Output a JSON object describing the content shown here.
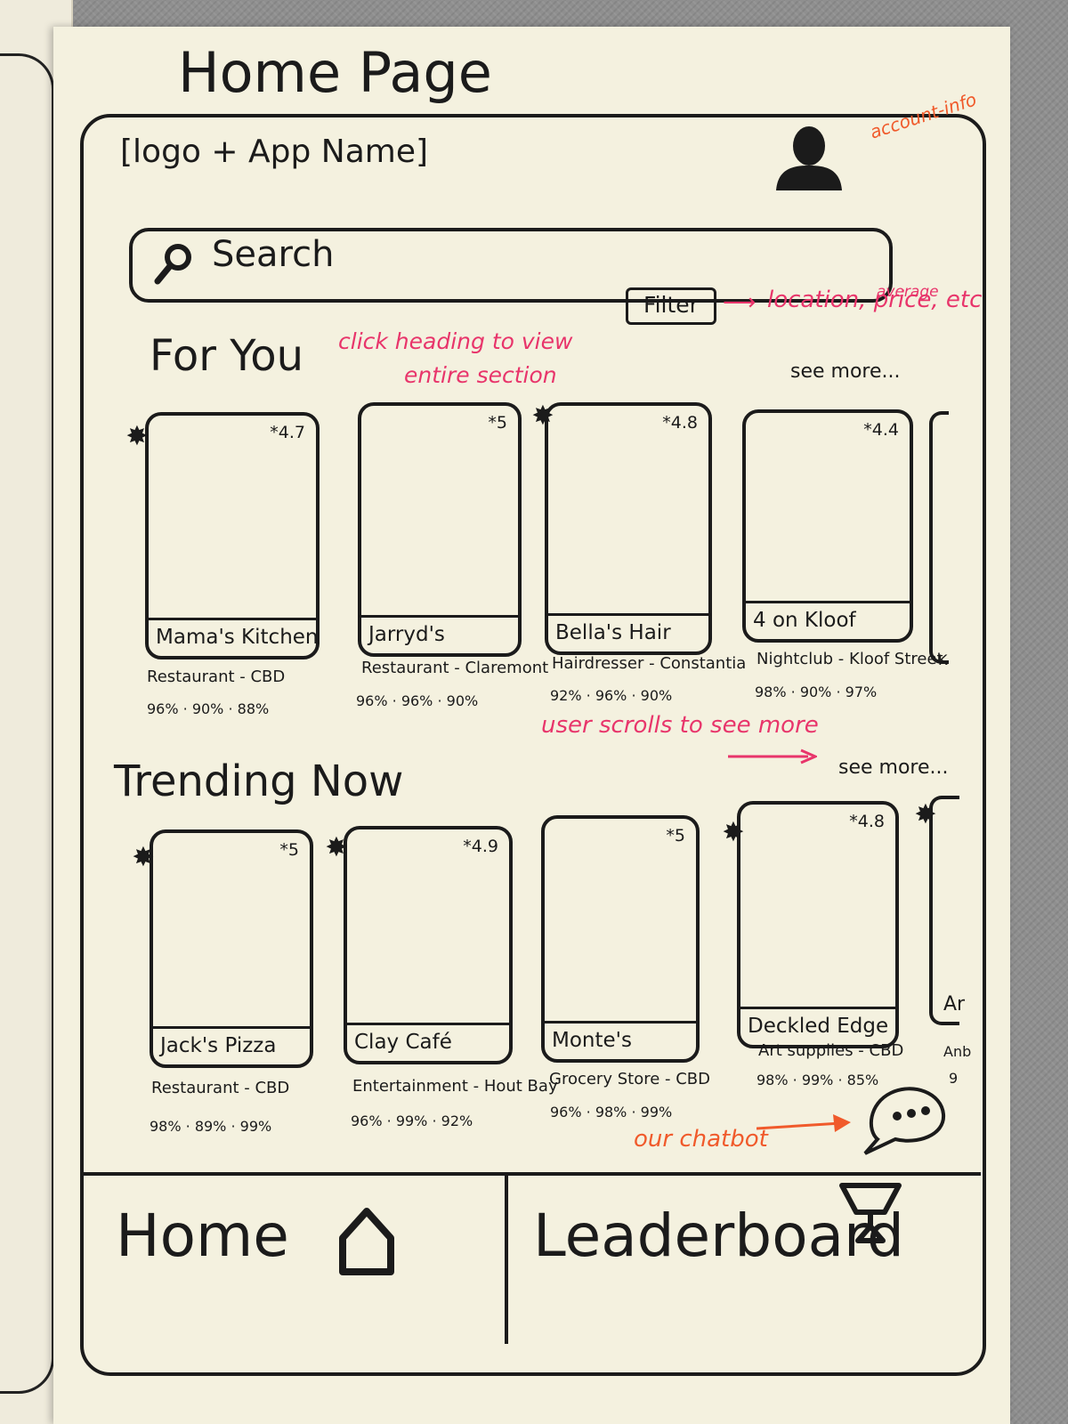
{
  "sheet": {
    "title": "Home Page"
  },
  "header": {
    "app_logo": "[logo + App Name]",
    "account_icon": "account-icon"
  },
  "search": {
    "placeholder": "Search",
    "icon": "search-icon"
  },
  "filter": {
    "label": "Filter"
  },
  "annotations": {
    "account": "account-info",
    "filter_main": "location, price, etc",
    "filter_small": "average",
    "heading": [
      "click heading to view",
      "entire section"
    ],
    "scroll": "user scrolls to see more",
    "chatbot": "our chatbot",
    "colors": {
      "pink": "#e8356b",
      "orange": "#f05a2b",
      "ink": "#1b1b1b"
    }
  },
  "for_you": {
    "title": "For You",
    "see_more": "see more...",
    "cards": [
      {
        "name": "Mama's Kitchen",
        "rating": "*4.7",
        "badge": true,
        "category": "Restaurant - CBD",
        "stats": "96% · 90% · 88%"
      },
      {
        "name": "Jarryd's",
        "rating": "*5",
        "badge": false,
        "category": "Restaurant - Claremont",
        "stats": "96% · 96% · 90%"
      },
      {
        "name": "Bella's Hair",
        "rating": "*4.8",
        "badge": true,
        "category": "Hairdresser - Constantia",
        "stats": "92% · 96% · 90%"
      },
      {
        "name": "4 on Kloof",
        "rating": "*4.4",
        "badge": false,
        "category": "Nightclub - Kloof Street",
        "stats": "98% · 90% · 97%"
      }
    ],
    "partial": {
      "category": "K"
    }
  },
  "trending": {
    "title": "Trending Now",
    "see_more": "see more...",
    "cards": [
      {
        "name": "Jack's Pizza",
        "rating": "*5",
        "badge": true,
        "category": "Restaurant - CBD",
        "stats": "98% · 89% · 99%"
      },
      {
        "name": "Clay Café",
        "rating": "*4.9",
        "badge": true,
        "category": "Entertainment - Hout Bay",
        "stats": "96% · 99% · 92%"
      },
      {
        "name": "Monte's",
        "rating": "*5",
        "badge": false,
        "category": "Grocery Store - CBD",
        "stats": "96% · 98% · 99%"
      },
      {
        "name": "Deckled Edge",
        "rating": "*4.8",
        "badge": true,
        "category": "Art supplies - CBD",
        "stats": "98% · 99% · 85%"
      }
    ],
    "partial": {
      "name": "Ar",
      "category": "Anb",
      "stats": "9"
    }
  },
  "nav": {
    "home_label": "Home",
    "leaderboard_label": "Leaderboard"
  }
}
